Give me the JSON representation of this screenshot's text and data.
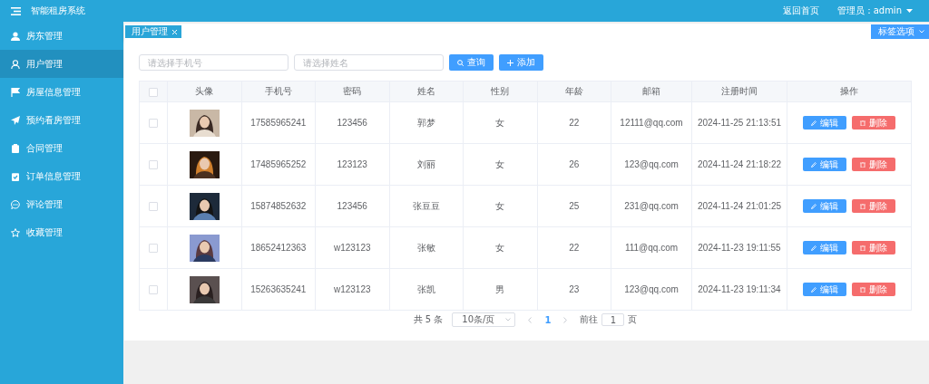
{
  "header": {
    "title": "智能租房系统",
    "home_link": "返回首页",
    "user_menu": "管理员：admin"
  },
  "sidebar": {
    "items": [
      {
        "label": "房东管理",
        "selected": false
      },
      {
        "label": "用户管理",
        "selected": true
      },
      {
        "label": "房屋信息管理",
        "selected": false
      },
      {
        "label": "预约看房管理",
        "selected": false
      },
      {
        "label": "合同管理",
        "selected": false
      },
      {
        "label": "订单信息管理",
        "selected": false
      },
      {
        "label": "评论管理",
        "selected": false
      },
      {
        "label": "收藏管理",
        "selected": false
      }
    ]
  },
  "tabs": [
    {
      "label": "用户管理",
      "selected": true
    }
  ],
  "tab_options": "标签选项",
  "search": {
    "phone_placeholder": "请选择手机号",
    "name_placeholder": "请选择姓名",
    "query_button": "查询",
    "add_button": "添加"
  },
  "table": {
    "select_all_checked": false,
    "columns": [
      "头像",
      "手机号",
      "密码",
      "姓名",
      "性别",
      "年龄",
      "邮箱",
      "注册时间",
      "操作"
    ],
    "rows": [
      {
        "checked": false,
        "phone": "17585965241",
        "password": "123456",
        "name": "郭梦",
        "gender": "女",
        "age": "22",
        "email": "12111@qq.com",
        "registered": "2024-11-25 21:13:51",
        "edit": "编辑",
        "delete": "删除"
      },
      {
        "checked": false,
        "phone": "17485965252",
        "password": "123123",
        "name": "刘丽",
        "gender": "女",
        "age": "26",
        "email": "123@qq.com",
        "registered": "2024-11-24 21:18:22",
        "edit": "编辑",
        "delete": "删除"
      },
      {
        "checked": false,
        "phone": "15874852632",
        "password": "123456",
        "name": "张豆豆",
        "gender": "女",
        "age": "25",
        "email": "231@qq.com",
        "registered": "2024-11-24 21:01:25",
        "edit": "编辑",
        "delete": "删除"
      },
      {
        "checked": false,
        "phone": "18652412363",
        "password": "w123123",
        "name": "张敏",
        "gender": "女",
        "age": "22",
        "email": "111@qq.com",
        "registered": "2024-11-23 19:11:55",
        "edit": "编辑",
        "delete": "删除"
      },
      {
        "checked": false,
        "phone": "15263635241",
        "password": "w123123",
        "name": "张凯",
        "gender": "男",
        "age": "23",
        "email": "123@qq.com",
        "registered": "2024-11-23 19:11:34",
        "edit": "编辑",
        "delete": "删除"
      }
    ]
  },
  "pagination": {
    "total": "共 5 条",
    "page_size": "10条/页",
    "pages": [
      {
        "label": "1",
        "selected": true
      }
    ],
    "goto_label": "前往",
    "goto_value": "1",
    "goto_suffix": "页"
  }
}
